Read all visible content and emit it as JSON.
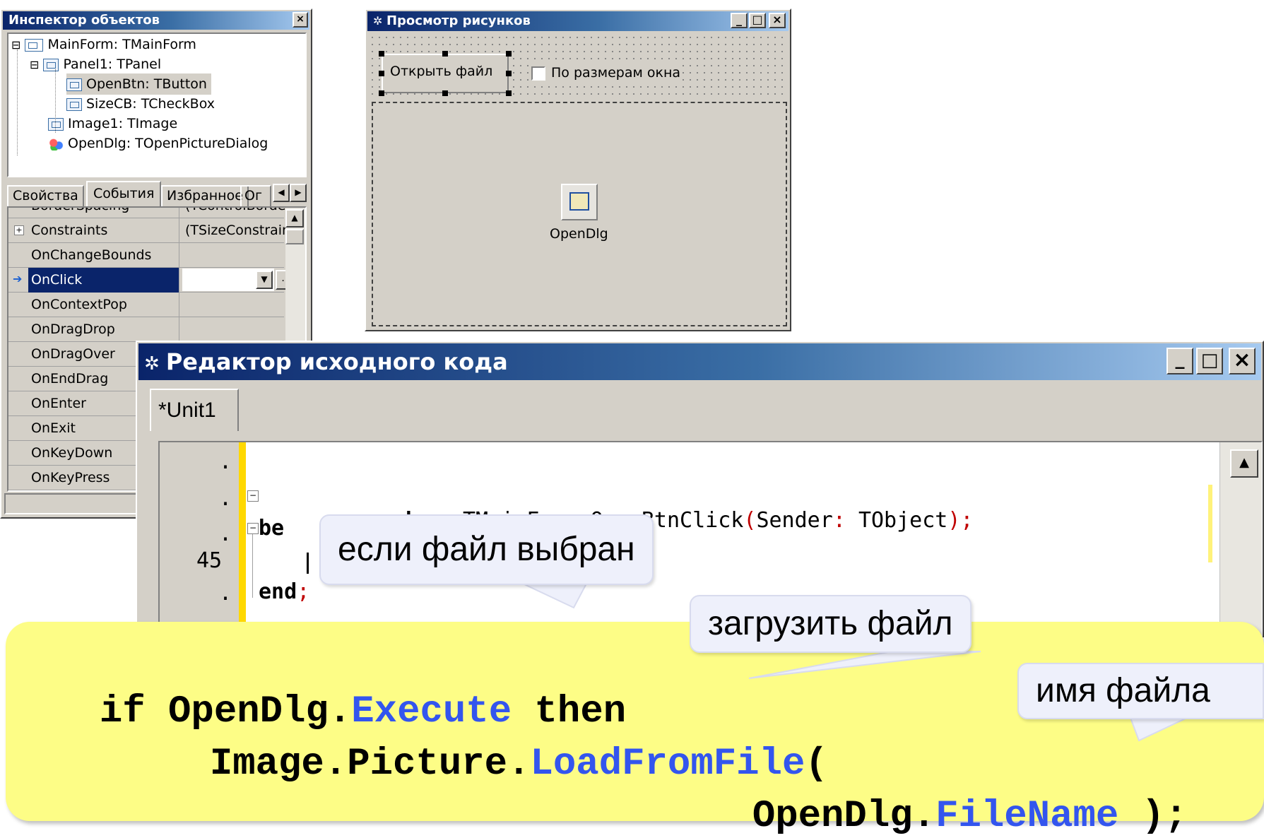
{
  "object_inspector": {
    "title": "Инспектор объектов",
    "tree": [
      {
        "expander": "⊟",
        "label": "MainForm: TMainForm"
      },
      {
        "expander": "⊟",
        "label": "Panel1: TPanel"
      },
      {
        "label": "OpenBtn: TButton"
      },
      {
        "label": "SizeCB: TCheckBox"
      },
      {
        "label": "Image1: TImage"
      },
      {
        "label": "OpenDlg: TOpenPictureDialog"
      }
    ],
    "tabs": [
      "Свойства",
      "События",
      "Избранное",
      "Ог"
    ],
    "active_tab": "События",
    "rows": [
      {
        "name": "BorderSpacing",
        "value": "(TControlBorderSpac"
      },
      {
        "name": "Constraints",
        "value": "(TSizeConstraints)"
      },
      {
        "name": "OnChangeBounds",
        "value": ""
      },
      {
        "name": "OnClick",
        "value": ""
      },
      {
        "name": "OnContextPop",
        "value": ""
      },
      {
        "name": "OnDragDrop",
        "value": ""
      },
      {
        "name": "OnDragOver",
        "value": ""
      },
      {
        "name": "OnEndDrag",
        "value": ""
      },
      {
        "name": "OnEnter",
        "value": ""
      },
      {
        "name": "OnExit",
        "value": ""
      },
      {
        "name": "OnKeyDown",
        "value": ""
      },
      {
        "name": "OnKeyPress",
        "value": ""
      }
    ],
    "selected_row": "OnClick",
    "ellipsis": "..."
  },
  "form_window": {
    "title": "Просмотр рисунков",
    "open_button": "Открыть файл",
    "checkbox_label": "По размерам окна",
    "component_label": "OpenDlg"
  },
  "code_editor": {
    "title": "Редактор исходного кода",
    "tab": "*Unit1",
    "gutter": [
      ".",
      ".",
      ".",
      "45",
      "."
    ],
    "line1_kw": "procedure",
    "line1_name": "TMainForm",
    "line1_dot": ".",
    "line1_method": "OpenBtnClick",
    "line1_open": "(",
    "line1_param": "Sender",
    "line1_colon": ":",
    "line1_type": "TObject",
    "line1_close": ");",
    "line2_kw": "be",
    "line4_kw": "end",
    "line4_semi": ";"
  },
  "callouts": {
    "file_selected": "если файл выбран",
    "load_file": "загрузить файл",
    "file_name": "имя файла"
  },
  "code_snippet": {
    "l1_if": "if OpenDlg.",
    "l1_method": "Execute",
    "l1_then": " then",
    "l2_obj": "Image.Picture.",
    "l2_method": "LoadFromFile",
    "l2_paren": "(",
    "l3_obj": "OpenDlg.",
    "l3_prop": "FileName",
    "l3_end": " );"
  },
  "colors": {
    "highlight_blue": "#3355ee",
    "snippet_bg": "#fdfd86",
    "title_active": "#0a246a"
  }
}
